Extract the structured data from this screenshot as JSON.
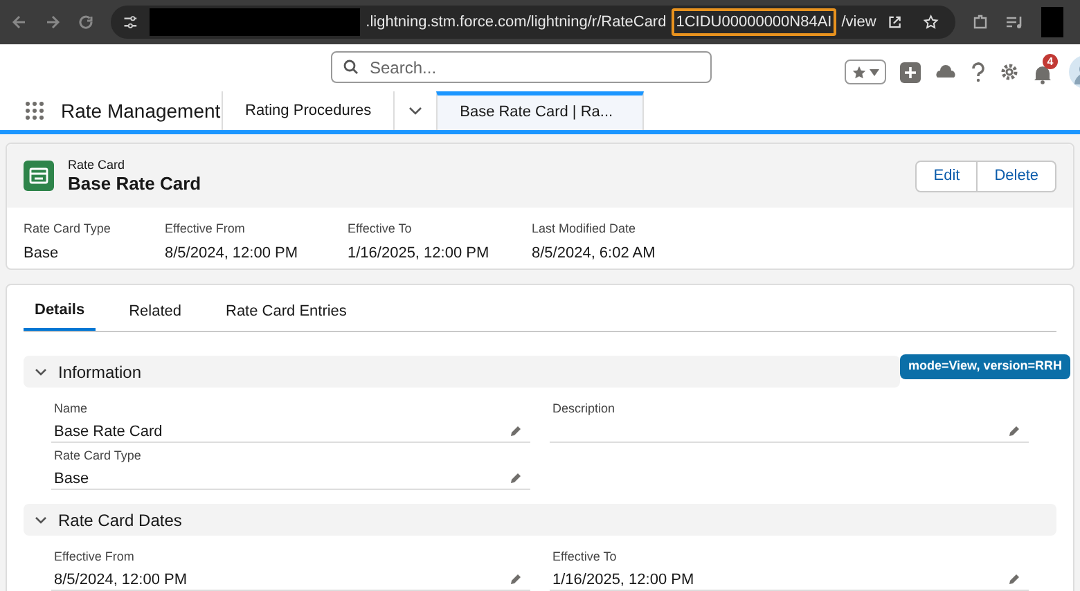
{
  "browser": {
    "url_prefix": ".lightning.stm.force.com/lightning/r/RateCard",
    "url_highlight": "1CIDU00000000N84AI",
    "url_suffix": "/view"
  },
  "header": {
    "search_placeholder": "Search...",
    "notification_count": "4"
  },
  "nav": {
    "app_name": "Rate Management",
    "tabs": [
      {
        "label": "Rating Procedures",
        "selected": false
      },
      {
        "label": "Base Rate Card | Ra...",
        "selected": true
      }
    ]
  },
  "record": {
    "object": "Rate Card",
    "title": "Base Rate Card",
    "actions": [
      "Edit",
      "Delete"
    ],
    "highlights": [
      {
        "label": "Rate Card Type",
        "value": "Base"
      },
      {
        "label": "Effective From",
        "value": "8/5/2024, 12:00 PM"
      },
      {
        "label": "Effective To",
        "value": "1/16/2025, 12:00 PM"
      },
      {
        "label": "Last Modified Date",
        "value": "8/5/2024, 6:02 AM"
      }
    ]
  },
  "detail_tabs": [
    {
      "label": "Details",
      "selected": true
    },
    {
      "label": "Related",
      "selected": false
    },
    {
      "label": "Rate Card Entries",
      "selected": false
    }
  ],
  "badge": "mode=View, version=RRH",
  "sections": [
    {
      "title": "Information",
      "expanded": true,
      "fields": [
        {
          "label": "Name",
          "value": "Base Rate Card"
        },
        {
          "label": "Description"
        },
        {
          "label": "Rate Card Type",
          "value": "Base"
        }
      ]
    },
    {
      "title": "Rate Card Dates",
      "expanded": true,
      "fields": [
        {
          "label": "Effective From",
          "value": "8/5/2024, 12:00 PM"
        },
        {
          "label": "Effective To",
          "value": "1/16/2025, 12:00 PM"
        }
      ]
    }
  ]
}
